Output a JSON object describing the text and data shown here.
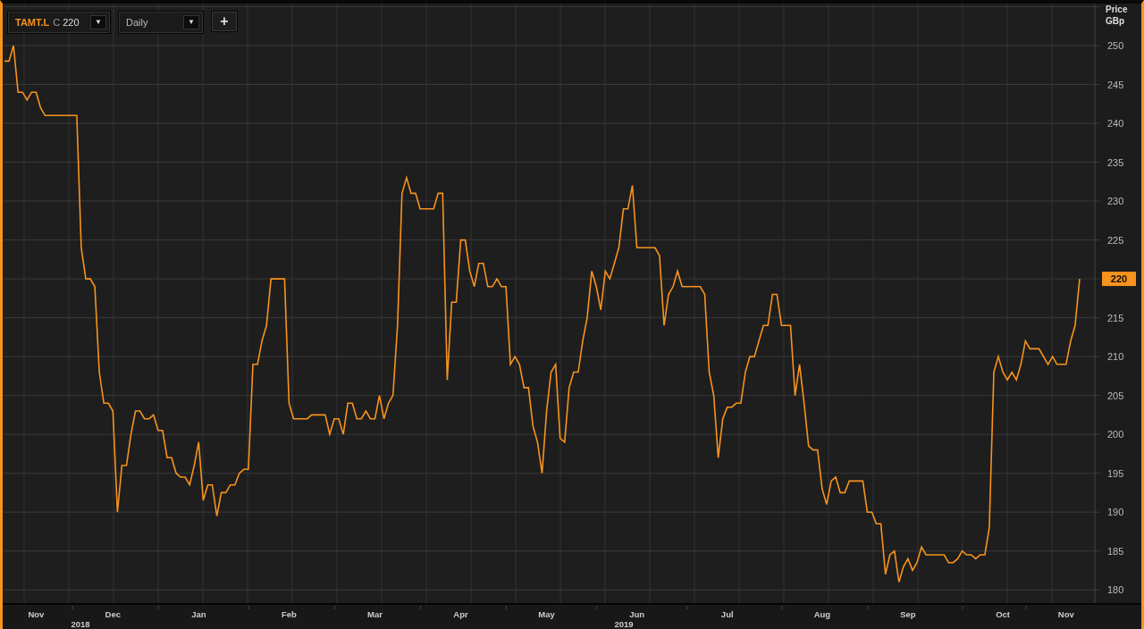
{
  "toolbar": {
    "price_label": "C",
    "price": "220",
    "symbol_dropdown": "▼",
    "interval": "Daily",
    "interval_dropdown": "▼",
    "add_button": "+"
  },
  "chart": {
    "last_price_tag": "220",
    "year_labels": [
      "2018",
      "2019"
    ],
    "chart_data": {
      "type": "line",
      "grid": true,
      "ylabel": "Price GBp",
      "ylim": [
        178.3,
        255.4
      ],
      "yticks": [
        180,
        185,
        190,
        195,
        200,
        205,
        210,
        215,
        225,
        230,
        235,
        240,
        245,
        250
      ],
      "categories": [
        null,
        null,
        null,
        null,
        null,
        null,
        null,
        "Nov",
        null,
        null,
        null,
        null,
        null,
        null,
        null,
        null,
        null,
        null,
        null,
        null,
        null,
        null,
        null,
        null,
        "Dec",
        null,
        null,
        null,
        null,
        null,
        null,
        null,
        null,
        null,
        null,
        null,
        null,
        null,
        null,
        null,
        null,
        null,
        null,
        "Jan",
        null,
        null,
        null,
        null,
        null,
        null,
        null,
        null,
        null,
        null,
        null,
        null,
        null,
        null,
        null,
        null,
        null,
        null,
        null,
        "Feb",
        null,
        null,
        null,
        null,
        null,
        null,
        null,
        null,
        null,
        null,
        null,
        null,
        null,
        null,
        null,
        null,
        null,
        null,
        "Mar",
        null,
        null,
        null,
        null,
        null,
        null,
        null,
        null,
        null,
        null,
        null,
        null,
        null,
        null,
        null,
        null,
        null,
        null,
        "Apr",
        null,
        null,
        null,
        null,
        null,
        null,
        null,
        null,
        null,
        null,
        null,
        null,
        null,
        null,
        null,
        null,
        null,
        null,
        "May",
        null,
        null,
        null,
        null,
        null,
        null,
        null,
        null,
        null,
        null,
        null,
        null,
        null,
        null,
        null,
        null,
        null,
        null,
        null,
        "Jun",
        null,
        null,
        null,
        null,
        null,
        null,
        null,
        null,
        null,
        null,
        null,
        null,
        null,
        null,
        null,
        null,
        null,
        null,
        null,
        "Jul",
        null,
        null,
        null,
        null,
        null,
        null,
        null,
        null,
        null,
        null,
        null,
        null,
        null,
        null,
        null,
        null,
        null,
        null,
        null,
        null,
        "Aug",
        null,
        null,
        null,
        null,
        null,
        null,
        null,
        null,
        null,
        null,
        null,
        null,
        null,
        null,
        null,
        null,
        null,
        null,
        "Sep",
        null,
        null,
        null,
        null,
        null,
        null,
        null,
        null,
        null,
        null,
        null,
        null,
        null,
        null,
        null,
        null,
        null,
        null,
        null,
        null,
        "Oct",
        null,
        null,
        null,
        null,
        null,
        null,
        null,
        null,
        null,
        null,
        null,
        null,
        null,
        "Nov",
        null,
        null,
        null
      ],
      "series": [
        {
          "name": "TAMT.L",
          "color": "#f7931e",
          "values": [
            248,
            248,
            250,
            244,
            244,
            243,
            244,
            244,
            242,
            241,
            241,
            241,
            241,
            241,
            241,
            241,
            241,
            224,
            220,
            220,
            219,
            208,
            204,
            204,
            203,
            190,
            196,
            196,
            200,
            203,
            203,
            202,
            202,
            202.5,
            200.5,
            200.5,
            197,
            197,
            195,
            194.5,
            194.5,
            193.5,
            196,
            199,
            191.5,
            193.5,
            193.5,
            189.5,
            192.5,
            192.5,
            193.5,
            193.5,
            195,
            195.5,
            195.5,
            209,
            209,
            212,
            214,
            220,
            220,
            220,
            220,
            204,
            202,
            202,
            202,
            202,
            202.5,
            202.5,
            202.5,
            202.5,
            200,
            202,
            202,
            200,
            204,
            204,
            202,
            202,
            203,
            202,
            202,
            205,
            202,
            204,
            205,
            214,
            231,
            233,
            231,
            231,
            229,
            229,
            229,
            229,
            231,
            231,
            207,
            217,
            217,
            225,
            225,
            221,
            219,
            222,
            222,
            219,
            219,
            220,
            219,
            219,
            209,
            210,
            209,
            206,
            206,
            201,
            199,
            195,
            203,
            208,
            209,
            199.5,
            199,
            206,
            208,
            208,
            212,
            215,
            221,
            219,
            216,
            221,
            220,
            222,
            224,
            229,
            229,
            232,
            224,
            224,
            224,
            224,
            224,
            223,
            214,
            218,
            219,
            221,
            219,
            219,
            219,
            219,
            219,
            218,
            208,
            205,
            197,
            202,
            203.5,
            203.5,
            204,
            204,
            208,
            210,
            210,
            212,
            214,
            214,
            218,
            218,
            214,
            214,
            214,
            205,
            209,
            204,
            198.5,
            198,
            198,
            193,
            191,
            194,
            194.5,
            192.5,
            192.5,
            194,
            194,
            194,
            194,
            190,
            190,
            188.5,
            188.5,
            182,
            184.5,
            185,
            181,
            183,
            184,
            182.5,
            183.5,
            185.5,
            184.5,
            184.5,
            184.5,
            184.5,
            184.5,
            183.5,
            183.5,
            184,
            185,
            184.5,
            184.5,
            184,
            184.5,
            184.5,
            188,
            208,
            210,
            208,
            207,
            208,
            207,
            209,
            212,
            211,
            211,
            211,
            210,
            209,
            210,
            209,
            209,
            209,
            212,
            214,
            220
          ]
        }
      ]
    }
  }
}
